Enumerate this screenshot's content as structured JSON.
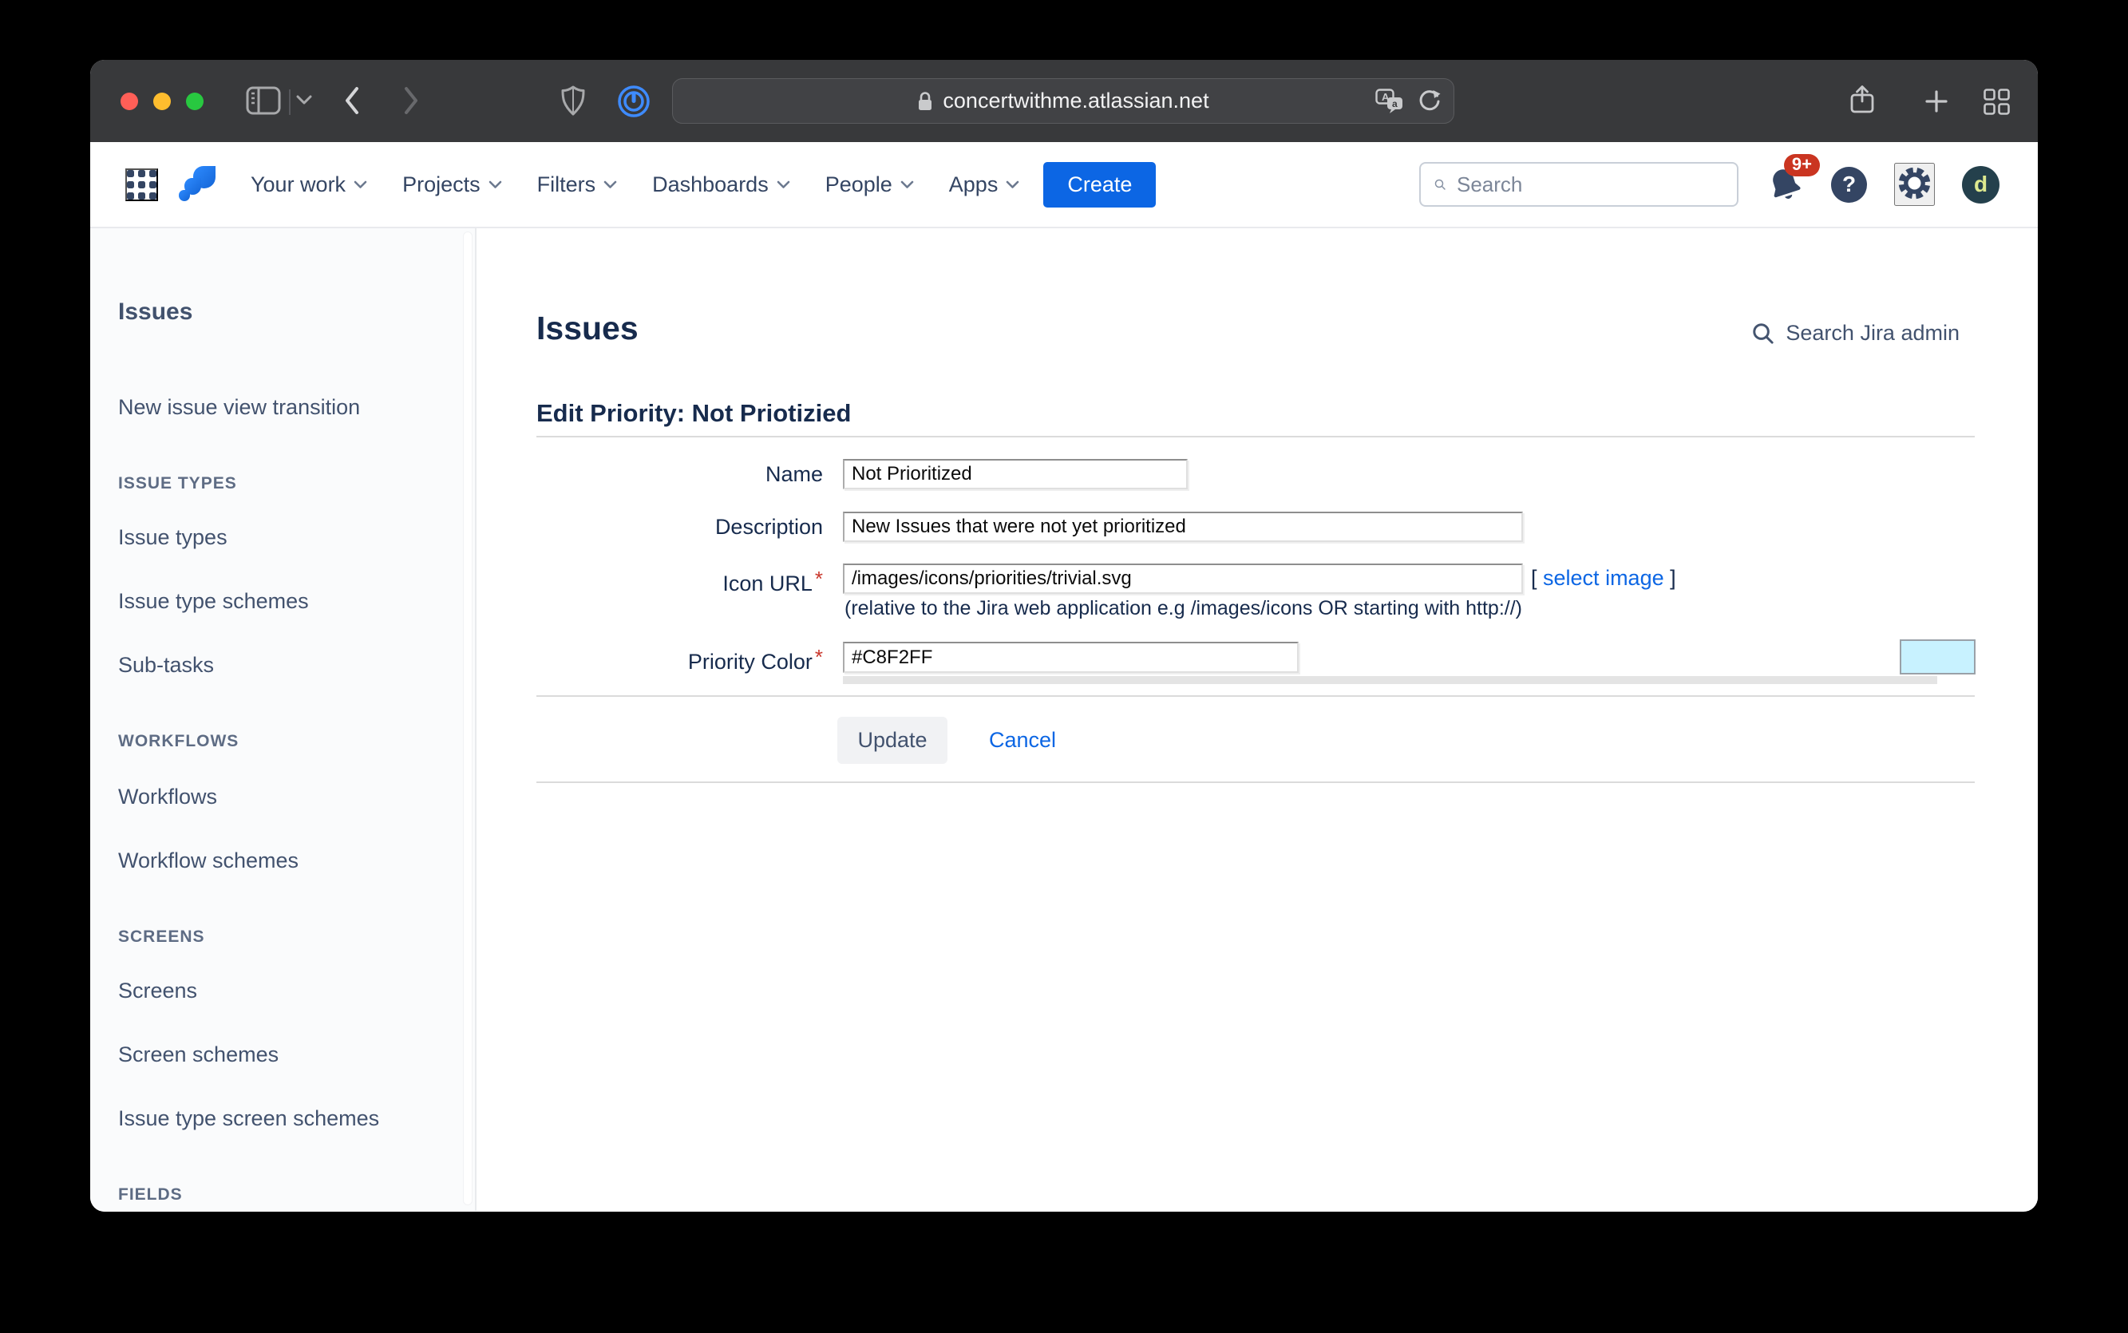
{
  "browser": {
    "url": "concertwithme.atlassian.net"
  },
  "navbar": {
    "items": [
      {
        "label": "Your work"
      },
      {
        "label": "Projects"
      },
      {
        "label": "Filters"
      },
      {
        "label": "Dashboards"
      },
      {
        "label": "People"
      },
      {
        "label": "Apps"
      }
    ],
    "create_label": "Create",
    "search_placeholder": "Search",
    "notification_badge": "9+",
    "avatar_initial": "d"
  },
  "sidebar": {
    "heading": "Issues",
    "items": [
      {
        "label": "New issue view transition",
        "type": "link"
      },
      {
        "label": "ISSUE TYPES",
        "type": "section"
      },
      {
        "label": "Issue types",
        "type": "link"
      },
      {
        "label": "Issue type schemes",
        "type": "link"
      },
      {
        "label": "Sub-tasks",
        "type": "link"
      },
      {
        "label": "WORKFLOWS",
        "type": "section"
      },
      {
        "label": "Workflows",
        "type": "link"
      },
      {
        "label": "Workflow schemes",
        "type": "link"
      },
      {
        "label": "SCREENS",
        "type": "section"
      },
      {
        "label": "Screens",
        "type": "link"
      },
      {
        "label": "Screen schemes",
        "type": "link"
      },
      {
        "label": "Issue type screen schemes",
        "type": "link"
      },
      {
        "label": "FIELDS",
        "type": "section"
      }
    ]
  },
  "main": {
    "page_title": "Issues",
    "admin_search": "Search Jira admin",
    "form_title": "Edit Priority: Not Priotizied",
    "name": {
      "label": "Name",
      "value": "Not Prioritized"
    },
    "description": {
      "label": "Description",
      "value": "New Issues that were not yet prioritized"
    },
    "icon_url": {
      "label": "Icon URL",
      "required_mark": "*",
      "value": "/images/icons/priorities/trivial.svg",
      "bracket_open": "[",
      "select_image": "select image",
      "bracket_close": "]",
      "helper": "(relative to the Jira web application e.g /images/icons OR starting with http://)"
    },
    "priority_color": {
      "label": "Priority Color",
      "required_mark": "*",
      "value": "#C8F2FF",
      "swatch": "#C8F2FF"
    },
    "update_label": "Update",
    "cancel_label": "Cancel"
  },
  "colors": {
    "create_button": "#0C66E4",
    "accent_blue": "#0C66E4",
    "badge_red": "#CA3521",
    "navy_text": "#42526E",
    "priority_swatch": "#C8F2FF"
  }
}
